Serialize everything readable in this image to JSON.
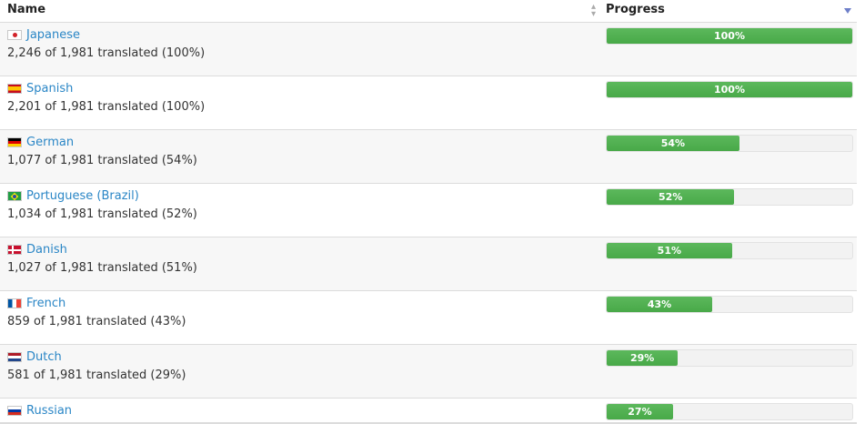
{
  "header": {
    "name_label": "Name",
    "progress_label": "Progress",
    "sort_icon": "sort-descending-icon"
  },
  "colors": {
    "link": "#2a86c6",
    "progress_fill": "#5cb85c",
    "progress_track": "#f2f2f2"
  },
  "languages": [
    {
      "name": "Japanese",
      "flag": "flag-jp",
      "detail": "2,246 of 1,981 translated (100%)",
      "percent_label": "100%",
      "progress": 100
    },
    {
      "name": "Spanish",
      "flag": "flag-es",
      "detail": "2,201 of 1,981 translated (100%)",
      "percent_label": "100%",
      "progress": 100
    },
    {
      "name": "German",
      "flag": "flag-de",
      "detail": "1,077 of 1,981 translated (54%)",
      "percent_label": "54%",
      "progress": 54
    },
    {
      "name": "Portuguese (Brazil)",
      "flag": "flag-br",
      "detail": "1,034 of 1,981 translated (52%)",
      "percent_label": "52%",
      "progress": 52
    },
    {
      "name": "Danish",
      "flag": "flag-dk",
      "detail": "1,027 of 1,981 translated (51%)",
      "percent_label": "51%",
      "progress": 51
    },
    {
      "name": "French",
      "flag": "flag-fr",
      "detail": "859 of 1,981 translated (43%)",
      "percent_label": "43%",
      "progress": 43
    },
    {
      "name": "Dutch",
      "flag": "flag-nl",
      "detail": "581 of 1,981 translated (29%)",
      "percent_label": "29%",
      "progress": 29
    },
    {
      "name": "Russian",
      "flag": "flag-ru",
      "detail": "",
      "percent_label": "27%",
      "progress": 27
    }
  ]
}
